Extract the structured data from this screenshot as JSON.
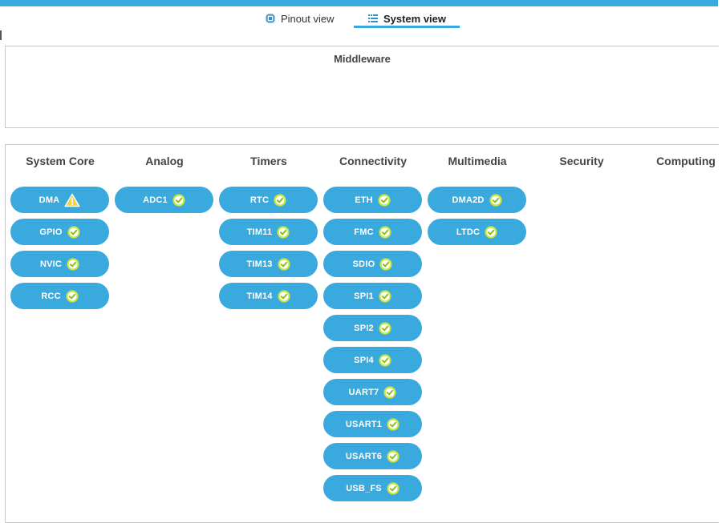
{
  "tabs": {
    "pinout_label": "Pinout view",
    "system_label": "System view",
    "active": "System view"
  },
  "middleware": {
    "title": "Middleware"
  },
  "categories": {
    "system_core": {
      "title": "System Core",
      "items": [
        {
          "label": "DMA",
          "status": "warning"
        },
        {
          "label": "GPIO",
          "status": "ok"
        },
        {
          "label": "NVIC",
          "status": "ok"
        },
        {
          "label": "RCC",
          "status": "ok"
        }
      ]
    },
    "analog": {
      "title": "Analog",
      "items": [
        {
          "label": "ADC1",
          "status": "ok"
        }
      ]
    },
    "timers": {
      "title": "Timers",
      "items": [
        {
          "label": "RTC",
          "status": "ok"
        },
        {
          "label": "TIM11",
          "status": "ok"
        },
        {
          "label": "TIM13",
          "status": "ok"
        },
        {
          "label": "TIM14",
          "status": "ok"
        }
      ]
    },
    "connectivity": {
      "title": "Connectivity",
      "items": [
        {
          "label": "ETH",
          "status": "ok"
        },
        {
          "label": "FMC",
          "status": "ok"
        },
        {
          "label": "SDIO",
          "status": "ok"
        },
        {
          "label": "SPI1",
          "status": "ok"
        },
        {
          "label": "SPI2",
          "status": "ok"
        },
        {
          "label": "SPI4",
          "status": "ok"
        },
        {
          "label": "UART7",
          "status": "ok"
        },
        {
          "label": "USART1",
          "status": "ok"
        },
        {
          "label": "USART6",
          "status": "ok"
        },
        {
          "label": "USB_FS",
          "status": "ok"
        }
      ]
    },
    "multimedia": {
      "title": "Multimedia",
      "items": [
        {
          "label": "DMA2D",
          "status": "ok"
        },
        {
          "label": "LTDC",
          "status": "ok"
        }
      ]
    },
    "security": {
      "title": "Security",
      "items": []
    },
    "computing": {
      "title": "Computing",
      "items": []
    }
  },
  "colors": {
    "accent": "#3aa9dd",
    "ok_icon": "#c8e63c",
    "warning_icon": "#f5d33a"
  },
  "icons": {
    "ok": "check-circle-icon",
    "warning": "warning-triangle-icon",
    "pinout_tab": "chip-icon",
    "system_tab": "list-icon"
  }
}
